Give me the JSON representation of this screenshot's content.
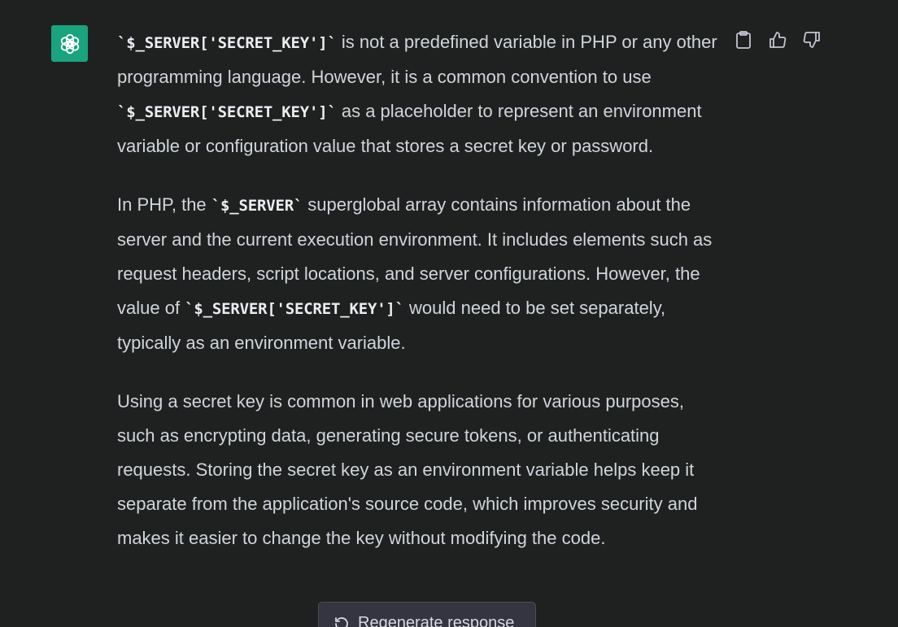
{
  "message": {
    "paragraphs": [
      {
        "segments": [
          {
            "code": true,
            "text": "`$_SERVER['SECRET_KEY']`"
          },
          {
            "code": false,
            "text": " is not a predefined variable in PHP or any other programming language. However, it is a common convention to use "
          },
          {
            "code": true,
            "text": "`$_SERVER['SECRET_KEY']`"
          },
          {
            "code": false,
            "text": " as a placeholder to represent an environment variable or configuration value that stores a secret key or password."
          }
        ]
      },
      {
        "segments": [
          {
            "code": false,
            "text": "In PHP, the "
          },
          {
            "code": true,
            "text": "`$_SERVER`"
          },
          {
            "code": false,
            "text": " superglobal array contains information about the server and the current execution environment. It includes elements such as request headers, script locations, and server configurations. However, the value of "
          },
          {
            "code": true,
            "text": "`$_SERVER['SECRET_KEY']`"
          },
          {
            "code": false,
            "text": " would need to be set separately, typically as an environment variable."
          }
        ]
      },
      {
        "segments": [
          {
            "code": false,
            "text": "Using a secret key is common in web applications for various purposes, such as encrypting data, generating secure tokens, or authenticating requests. Storing the secret key as an environment variable helps keep it separate from the application's source code, which improves security and makes it easier to change the key without modifying the code."
          }
        ]
      }
    ]
  },
  "actions": {
    "copy_icon": "clipboard-icon",
    "like_icon": "thumbs-up-icon",
    "dislike_icon": "thumbs-down-icon"
  },
  "regenerate": {
    "label": "Regenerate response",
    "icon": "refresh-icon"
  },
  "colors": {
    "background": "#1f2121",
    "avatar": "#19a37f",
    "text": "#d1d5db"
  }
}
